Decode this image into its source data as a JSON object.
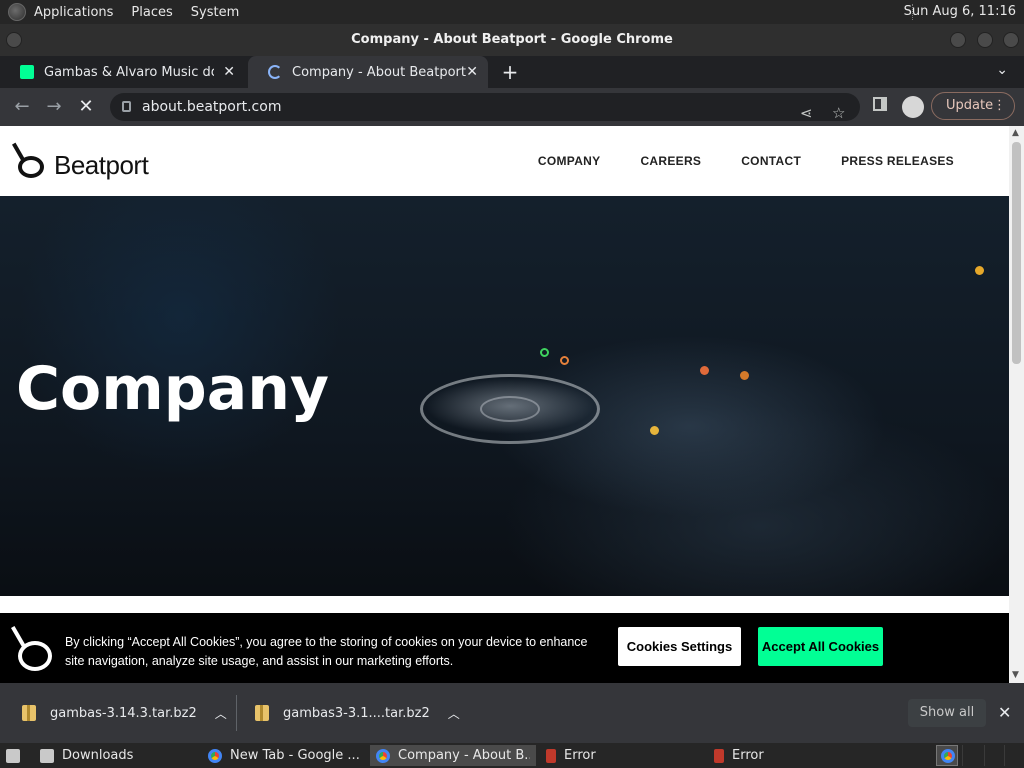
{
  "top_panel": {
    "menus": [
      "Applications",
      "Places",
      "System"
    ],
    "clock": "Sun Aug  6, 11:16"
  },
  "window": {
    "title": "Company - About Beatport - Google Chrome"
  },
  "tabs": [
    {
      "label": "Gambas & Alvaro Music downl",
      "active": false
    },
    {
      "label": "Company - About Beatport",
      "active": true
    }
  ],
  "toolbar": {
    "url": "about.beatport.com",
    "update_label": "Update"
  },
  "site": {
    "brand": "Beatport",
    "nav": [
      "COMPANY",
      "CAREERS",
      "CONTACT",
      "PRESS RELEASES"
    ],
    "hero_title": "Company"
  },
  "cookie_banner": {
    "text": "By clicking “Accept All Cookies”, you agree to the storing of cookies on your device to enhance site navigation, analyze site usage, and assist in our marketing efforts.",
    "settings_label": "Cookies Settings",
    "accept_label": "Accept All Cookies",
    "accept_color": "#01ff95"
  },
  "downloads": {
    "items": [
      "gambas-3.14.3.tar.bz2",
      "gambas3-3.1....tar.bz2"
    ],
    "show_all_label": "Show all"
  },
  "taskbar": {
    "tasks": [
      "Downloads",
      "New Tab - Google ...",
      "Company - About B...",
      "Error",
      "Error"
    ]
  }
}
